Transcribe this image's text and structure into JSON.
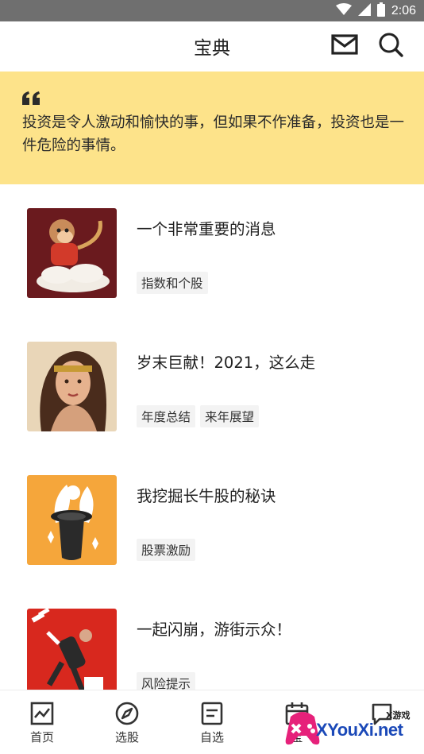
{
  "status_bar": {
    "time": "2:06"
  },
  "header": {
    "title": "宝典"
  },
  "quote": {
    "text": "投资是令人激动和愉快的事，但如果不作准备，投资也是一件危险的事情。"
  },
  "articles": [
    {
      "title": "一个非常重要的消息",
      "tags": [
        "指数和个股"
      ]
    },
    {
      "title": "岁末巨献！2021，这么走",
      "tags": [
        "年度总结",
        "来年展望"
      ]
    },
    {
      "title": "我挖掘长牛股的秘诀",
      "tags": [
        "股票激励"
      ]
    },
    {
      "title": "一起闪崩，游街示众！",
      "tags": [
        "风险提示"
      ]
    }
  ],
  "bottom_nav": {
    "items": [
      {
        "label": "首页",
        "icon": "chart-icon"
      },
      {
        "label": "选股",
        "icon": "compass-icon"
      },
      {
        "label": "自选",
        "icon": "list-icon"
      },
      {
        "label": "宝",
        "icon": "calendar-icon"
      },
      {
        "label": "",
        "icon": "chat-icon"
      }
    ]
  },
  "watermark": {
    "small": "X游戏",
    "main": "XYouXi.net"
  },
  "colors": {
    "banner": "#fde38a",
    "tag_bg": "#f3f3f3",
    "status_bar": "#6f6f6f",
    "watermark_blue": "#1b49b8",
    "watermark_pink": "#e6217a"
  }
}
